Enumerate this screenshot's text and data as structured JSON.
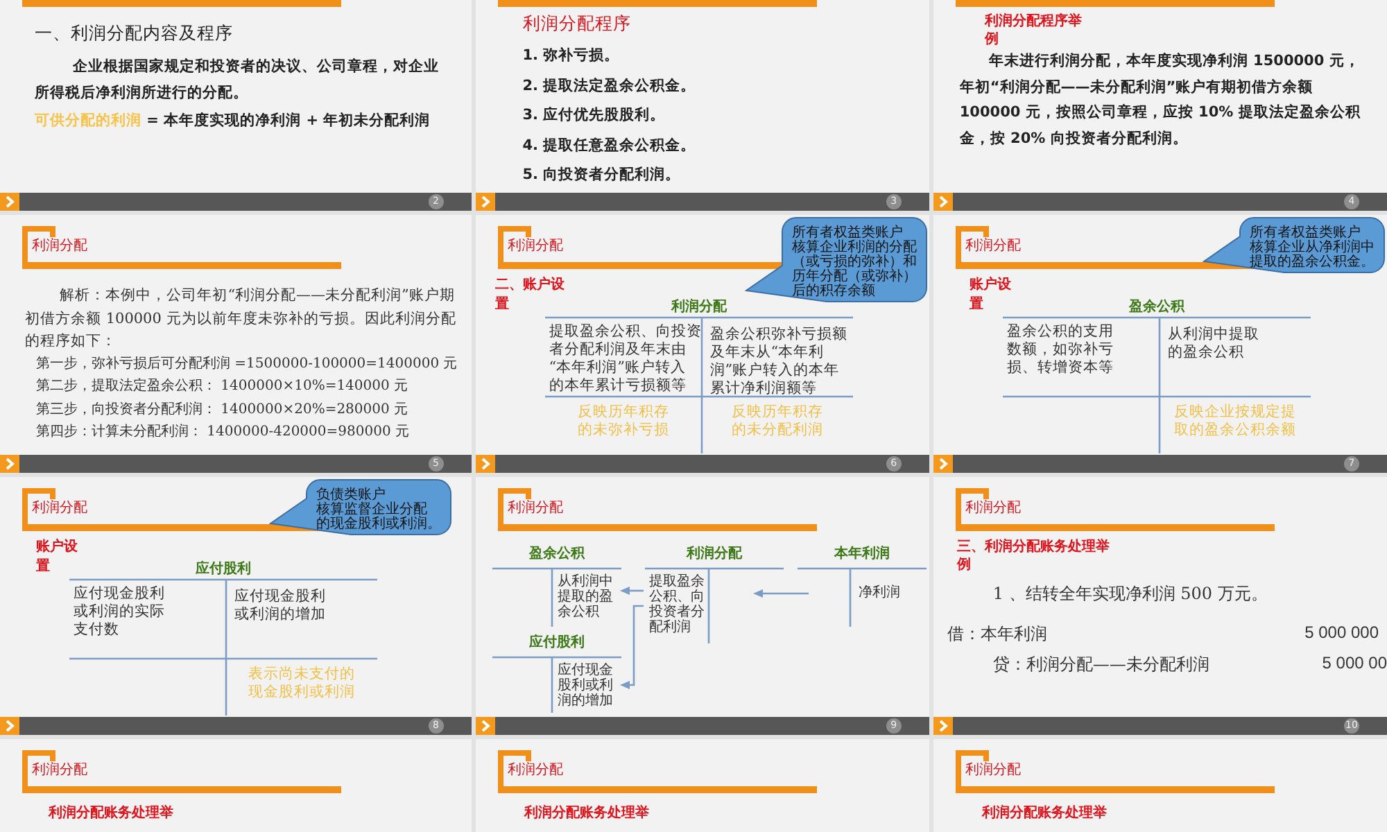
{
  "slides": [
    {
      "kind": "intro",
      "page": "2",
      "heading": "一、利润分配内容及程序",
      "paragraph": "企业根据国家规定和投资者的决议、公司章程，对企业所得税后净利润所进行的分配。",
      "formula": {
        "term": "可供分配的利润",
        "expression": "= 本年度实现的净利润 + 年初未分配利润"
      }
    },
    {
      "kind": "list",
      "page": "3",
      "heading": "利润分配程序",
      "items": [
        "1. 弥补亏损。",
        "2. 提取法定盈余公积金。",
        "3. 应付优先股股利。",
        "4. 提取任意盈余公积金。",
        "5. 向投资者分配利润。"
      ]
    },
    {
      "kind": "example",
      "page": "4",
      "subtitle": "利润分配程序举例",
      "paragraph": "年末进行利润分配，本年度实现净利润 1500000 元，年初“利润分配——未分配利润”账户有期初借方余额 100000 元，按照公司章程，应按 10% 提取法定盈余公积金，按 20% 向投资者分配利润。"
    },
    {
      "kind": "analysis",
      "page": "5",
      "title": "利润分配",
      "paragraph": "解析：本例中，公司年初“利润分配——未分配利润”账户期初借方余额 100000 元为以前年度未弥补的亏损。因此利润分配的程序如下：",
      "steps": [
        "第一步，弥补亏损后可分配利润 =1500000-100000=1400000 元",
        "第二步，提取法定盈余公积： 1400000×10%=140000 元",
        "第三步，向投资者分配利润： 1400000×20%=280000 元",
        "第四步：计算未分配利润： 1400000-420000=980000 元"
      ]
    },
    {
      "kind": "t_account",
      "page": "6",
      "title": "利润分配",
      "section": "二、账户设置",
      "callout": [
        "所有者权益类账户",
        "核算企业利润的分配",
        "（或亏损的弥补）和",
        "历年分配（或弥补）",
        "后的积存余额"
      ],
      "account": "利润分配",
      "debit": [
        "提取盈余公积、向投资",
        "者分配利润及年末由",
        "“本年利润”账户转入",
        "的本年累计亏损额等"
      ],
      "credit": [
        "盈余公积弥补亏损额",
        "及年末从“本年利",
        "润”账户转入的本年",
        "累计净利润额等"
      ],
      "debit_balance": [
        "反映历年积存",
        "的未弥补亏损"
      ],
      "credit_balance": [
        "反映历年积存",
        "的未分配利润"
      ]
    },
    {
      "kind": "t_account",
      "page": "7",
      "title": "利润分配",
      "section": "账户设置",
      "callout": [
        "所有者权益类账户",
        "核算企业从净利润中",
        "提取的盈余公积金。"
      ],
      "account": "盈余公积",
      "debit": [
        "盈余公积的支用",
        "数额，如弥补亏",
        "损、转增资本等"
      ],
      "credit": [
        "从利润中提取",
        "的盈余公积"
      ],
      "credit_balance": [
        "反映企业按规定提",
        "取的盈余公积余额"
      ]
    },
    {
      "kind": "t_account",
      "page": "8",
      "title": "利润分配",
      "section": "账户设置",
      "callout": [
        "负债类账户",
        "核算监督企业分配",
        "的现金股利或利润。"
      ],
      "account": "应付股利",
      "debit": [
        "应付现金股利",
        "或利润的实际",
        "支付数"
      ],
      "credit": [
        "应付现金股利",
        "或利润的增加"
      ],
      "credit_balance": [
        "表示尚未支付的",
        "现金股利或利润"
      ]
    },
    {
      "kind": "flow",
      "page": "9",
      "title": "利润分配",
      "accounts": [
        {
          "name": "盈余公积",
          "lines": [
            "从利润中",
            "提取的盈",
            "余公积"
          ]
        },
        {
          "name": "利润分配",
          "lines": [
            "提取盈余",
            "公积、向",
            "投资者分",
            "配利润"
          ]
        },
        {
          "name": "本年利润",
          "lines": [
            "净利润"
          ]
        },
        {
          "name": "应付股利",
          "lines": [
            "应付现金",
            "股利或利",
            "润的增加"
          ]
        }
      ]
    },
    {
      "kind": "entry",
      "page": "10",
      "title": "利润分配",
      "section": "三、利润分配账务处理举例",
      "line": "1 、结转全年实现净利润 500 万元。",
      "entries": [
        {
          "account": "借：本年利润",
          "amount": "5 000 000"
        },
        {
          "account": "贷：利润分配——未分配利润",
          "amount": "5 000 00"
        }
      ]
    },
    {
      "kind": "stub",
      "title": "利润分配",
      "subtitle": "利润分配账务处理举"
    },
    {
      "kind": "stub",
      "title": "利润分配",
      "subtitle": "利润分配账务处理举"
    },
    {
      "kind": "stub",
      "title": "利润分配",
      "subtitle": "利润分配账务处理举"
    }
  ]
}
